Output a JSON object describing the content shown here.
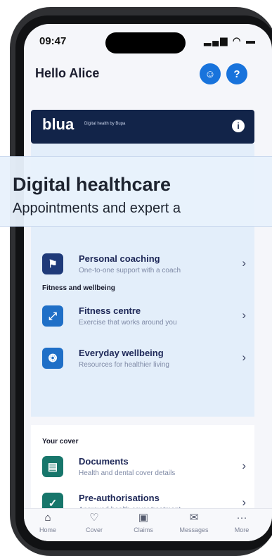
{
  "status_bar": {
    "time": "09:47",
    "icons": "..ıl ᯤ ▬"
  },
  "header": {
    "greeting": "Hello Alice"
  },
  "banner": {
    "brand": "blua",
    "tagline": "Digital health by Bupa"
  },
  "overlay": {
    "title": "Digital healthcare",
    "subtitle": "Appointments and expert a"
  },
  "digital_health": {
    "items": [
      {
        "title": "Personal coaching",
        "subtitle": "One-to-one support with a coach"
      }
    ]
  },
  "fitness": {
    "section_title": "Fitness and wellbeing",
    "items": [
      {
        "title": "Fitness centre",
        "subtitle": "Exercise that works around you"
      },
      {
        "title": "Everyday wellbeing",
        "subtitle": "Resources for healthier living"
      }
    ]
  },
  "cover": {
    "section_title": "Your cover",
    "items": [
      {
        "title": "Documents",
        "subtitle": "Health and dental cover details"
      },
      {
        "title": "Pre-authorisations",
        "subtitle": "Approved health cover treatment"
      }
    ]
  },
  "tabbar": {
    "tabs": [
      {
        "label": "Home",
        "icon": "home-icon"
      },
      {
        "label": "Cover",
        "icon": "cover-icon"
      },
      {
        "label": "Claims",
        "icon": "claims-icon"
      },
      {
        "label": "Messages",
        "icon": "messages-icon"
      },
      {
        "label": "More",
        "icon": "more-icon"
      }
    ]
  },
  "colors": {
    "navy": "#122449",
    "accent_blue": "#1873dc",
    "panel": "#e3eefa"
  }
}
